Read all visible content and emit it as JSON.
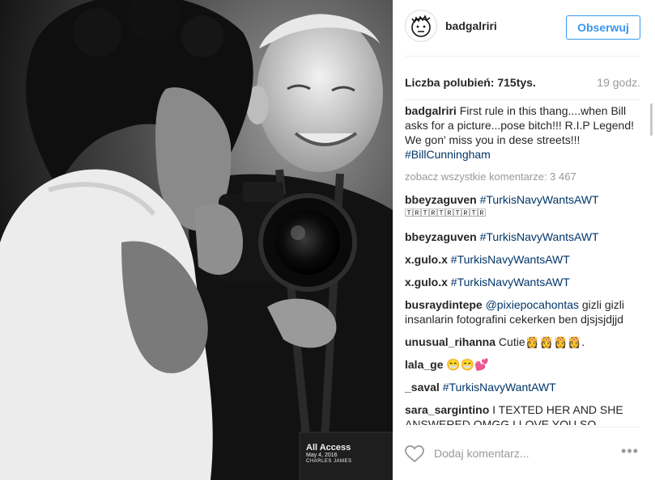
{
  "post": {
    "photo_badge": {
      "line1": "All Access",
      "line2": "May 4, 2016",
      "line3": "CHARLES JAMES"
    }
  },
  "header": {
    "username": "badgalriri",
    "follow_label": "Obserwuj",
    "avatar_icon": "doodle-face-avatar"
  },
  "stats": {
    "likes": "Liczba polubień: 715tys.",
    "time": "19 godz."
  },
  "caption": {
    "user": "badgalriri",
    "text": "First rule in this thang....when Bill asks for a picture...pose bitch!!! R.I.P Legend!  We gon' miss you in dese streets!!! ",
    "hashtag": "#BillCunningham"
  },
  "view_all": "zobacz wszystkie komentarze: 3 467",
  "comments": [
    {
      "user": "bbeyzaguven",
      "tag": "#TurkisNavyWantsAWT",
      "text": "",
      "extra": "🅃🅁🅃🅁🅃🅁🅃🅁🅃🅁"
    },
    {
      "user": "bbeyzaguven",
      "tag": "#TurkisNavyWantsAWT",
      "text": "",
      "extra": ""
    },
    {
      "user": "x.gulo.x",
      "tag": "#TurkisNavyWantsAWT",
      "text": "",
      "extra": ""
    },
    {
      "user": "x.gulo.x",
      "tag": "#TurkisNavyWantsAWT",
      "text": "",
      "extra": ""
    },
    {
      "user": "busraydintepe",
      "tag": "@pixiepocahontas",
      "text": " gizli gizli insanlarin fotografini cekerken ben djsjsjdjjd",
      "extra": ""
    },
    {
      "user": "unusual_rihanna",
      "tag": "",
      "text": "Cutie👸👸👸👸.",
      "extra": ""
    },
    {
      "user": "lala_ge",
      "tag": "",
      "text": "😁😁💕",
      "extra": ""
    },
    {
      "user": "_saval",
      "tag": "#TurkisNavyWantAWT",
      "text": "",
      "extra": ""
    },
    {
      "user": "sara_sargintino",
      "tag": "",
      "text": "I TEXTED HER AND SHE ANSWERED OMGG I LOVE YOU SO",
      "extra": ""
    }
  ],
  "footer": {
    "comment_placeholder": "Dodaj komentarz...",
    "like_icon": "heart-outline-icon",
    "more_icon": "more-options-icon",
    "more_label": "•••"
  },
  "colors": {
    "accent": "#3897f0",
    "hashtag": "#003569",
    "muted": "#999999",
    "text": "#262626"
  }
}
